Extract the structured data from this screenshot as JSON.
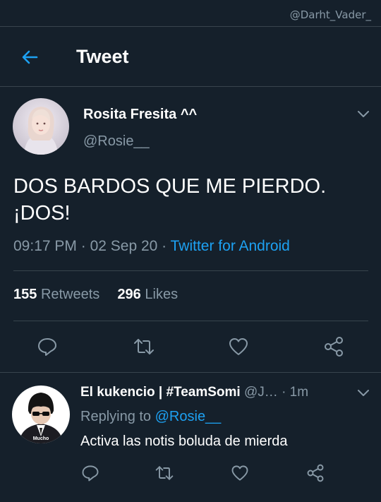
{
  "watermark": "@Darht_Vader_",
  "header": {
    "title": "Tweet"
  },
  "tweet": {
    "author_name": "Rosita Fresita ^^",
    "author_handle": "@Rosie__",
    "text_line1": "DOS BARDOS QUE ME PIERDO.",
    "text_line2": "¡DOS!",
    "time": "09:17 PM",
    "sep1": " · ",
    "date": "02 Sep 20",
    "sep2": " · ",
    "source": "Twitter for Android",
    "retweets_count": "155",
    "retweets_label": "Retweets",
    "likes_count": "296",
    "likes_label": "Likes"
  },
  "reply": {
    "author_name": "El kukencio | #TeamSomi",
    "author_handle": "@J…",
    "time": "· 1m",
    "replying_prefix": "Replying to ",
    "replying_to": "@Rosie__",
    "text": "Activa las notis boluda de mierda",
    "avatar_caption": "Mucho"
  },
  "icons": {
    "back": "arrow-left-icon",
    "more": "chevron-down-icon",
    "reply": "comment-icon",
    "retweet": "retweet-icon",
    "like": "heart-icon",
    "share": "share-icon"
  },
  "colors": {
    "background": "#15202b",
    "accent": "#1da1f2",
    "secondary_text": "#8899a6",
    "divider": "#38444d"
  }
}
